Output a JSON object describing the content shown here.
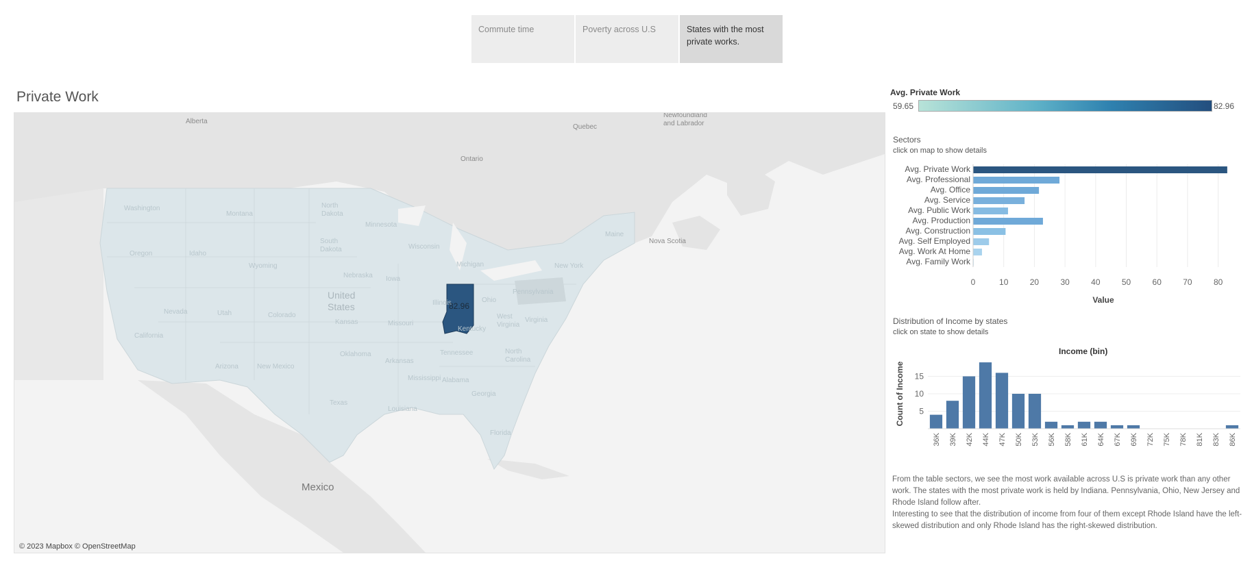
{
  "tabs": [
    {
      "label": "Commute time",
      "active": false
    },
    {
      "label": "Poverty across U.S",
      "active": false
    },
    {
      "label": "States with the most private works.",
      "active": true
    }
  ],
  "page_title": "Private Work",
  "map": {
    "copyright": "© 2023 Mapbox © OpenStreetMap",
    "region_labels": [
      "Alberta",
      "Quebec",
      "Newfoundland and Labrador",
      "Ontario",
      "Nova Scotia",
      "Mexico",
      "United States"
    ],
    "state_labels": [
      "Washington",
      "Oregon",
      "Montana",
      "Idaho",
      "North Dakota",
      "South Dakota",
      "Minnesota",
      "Wisconsin",
      "Michigan",
      "Wyoming",
      "Nevada",
      "Utah",
      "Colorado",
      "Nebraska",
      "Iowa",
      "Illinois",
      "Ohio",
      "Pennsylvania",
      "New York",
      "Maine",
      "Kansas",
      "Missouri",
      "Kentucky",
      "West Virginia",
      "Virginia",
      "California",
      "Arizona",
      "New Mexico",
      "Oklahoma",
      "Arkansas",
      "Tennessee",
      "North Carolina",
      "Mississippi",
      "Alabama",
      "Georgia",
      "Texas",
      "Louisiana",
      "Florida"
    ],
    "highlighted_state": "Indiana",
    "highlighted_value": "82.96",
    "colors": {
      "highlight": "#2b5680",
      "base": "#dce6ea",
      "land": "#e6e6e6",
      "water": "#f3f3f3"
    }
  },
  "legend": {
    "title": "Avg. Private Work",
    "min": "59.65",
    "max": "82.96"
  },
  "sectors": {
    "title": "Sectors",
    "subtitle": "click on map to show details",
    "chart_data": {
      "type": "bar",
      "orientation": "horizontal",
      "categories": [
        "Avg. Private Work",
        "Avg. Professional",
        "Avg. Office",
        "Avg. Service",
        "Avg. Public Work",
        "Avg. Production",
        "Avg. Construction",
        "Avg. Self Employed",
        "Avg. Work At Home",
        "Avg. Family Work"
      ],
      "values": [
        82.96,
        28.2,
        21.5,
        16.8,
        11.4,
        22.8,
        10.6,
        5.2,
        2.9,
        0.2
      ],
      "colors": [
        "#2b5680",
        "#6fa9d8",
        "#6fa9d8",
        "#79b0dc",
        "#86bbe2",
        "#6fa9d8",
        "#8ac0e4",
        "#9dcbea",
        "#a9d3ee",
        "#bfe0f4"
      ],
      "xlabel": "Value",
      "ticks": [
        0,
        10,
        20,
        30,
        40,
        50,
        60,
        70,
        80
      ],
      "xlim": [
        0,
        85
      ]
    }
  },
  "income": {
    "title": "Distribution of Income by states",
    "subtitle": "click on state to show details",
    "chart_data": {
      "type": "bar",
      "title": "Income (bin)",
      "ylabel": "Count of Income",
      "categories": [
        "36K",
        "39K",
        "42K",
        "44K",
        "47K",
        "50K",
        "53K",
        "56K",
        "58K",
        "61K",
        "64K",
        "67K",
        "69K",
        "72K",
        "75K",
        "78K",
        "81K",
        "83K",
        "86K"
      ],
      "values": [
        4,
        8,
        15,
        19,
        16,
        10,
        10,
        2,
        1,
        2,
        2,
        1,
        1,
        0,
        0,
        0,
        0,
        0,
        1
      ],
      "yticks": [
        5,
        10,
        15
      ],
      "ylim": [
        0,
        20
      ],
      "color": "#4e79a7"
    }
  },
  "notes": [
    "From the table sectors, we see the most work available across U.S is private work than any other work. The states with the most private work is held by Indiana. Pennsylvania, Ohio, New Jersey and Rhode Island follow after.",
    "Interesting to see that the distribution of income from four of them except Rhode Island have the left-skewed distribution and only Rhode Island has the right-skewed distribution."
  ]
}
